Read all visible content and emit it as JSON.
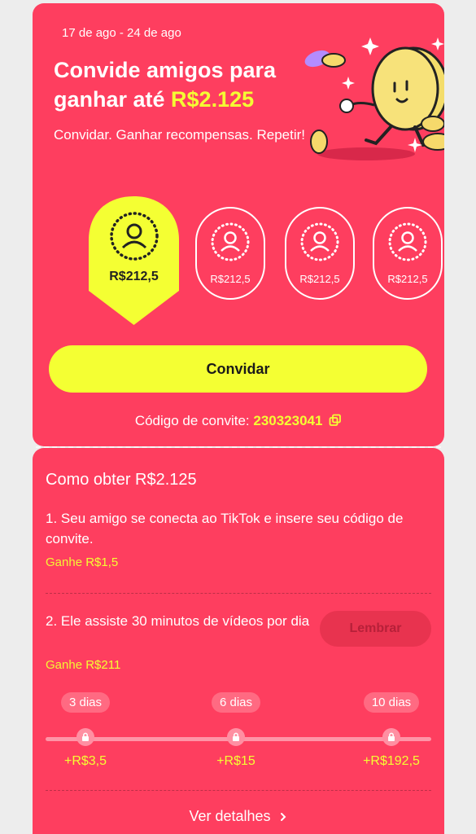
{
  "header": {
    "dates": "17 de ago - 24 de ago",
    "title_prefix": "Convide amigos para ganhar até ",
    "title_amount": "R$2.125",
    "subtitle": "Convidar. Ganhar recompensas. Repetir!"
  },
  "steps": [
    {
      "amount": "R$212,5",
      "active": true
    },
    {
      "amount": "R$212,5",
      "active": false
    },
    {
      "amount": "R$212,5",
      "active": false
    },
    {
      "amount": "R$212,5",
      "active": false
    }
  ],
  "invite_button": "Convidar",
  "invite_code": {
    "label": "Código de convite: ",
    "code": "230323041"
  },
  "how": {
    "title": "Como obter R$2.125",
    "task1": {
      "text": "1. Seu amigo se conecta ao TikTok e insere seu código de convite.",
      "reward_label": "Ganhe ",
      "reward_value": "R$1,5"
    },
    "task2": {
      "text": "2. Ele assiste 30 minutos de vídeos por dia",
      "reward_label": "Ganhe ",
      "reward_value": "R$211",
      "button": "Lembrar"
    },
    "milestones": [
      {
        "days": "3 dias",
        "gain": "+R$3,5"
      },
      {
        "days": "6 dias",
        "gain": "+R$15"
      },
      {
        "days": "10 dias",
        "gain": "+R$192,5"
      }
    ],
    "details": "Ver detalhes"
  },
  "colors": {
    "background": "#fe3e5f",
    "accent": "#f4ff33",
    "page": "#ededed"
  }
}
